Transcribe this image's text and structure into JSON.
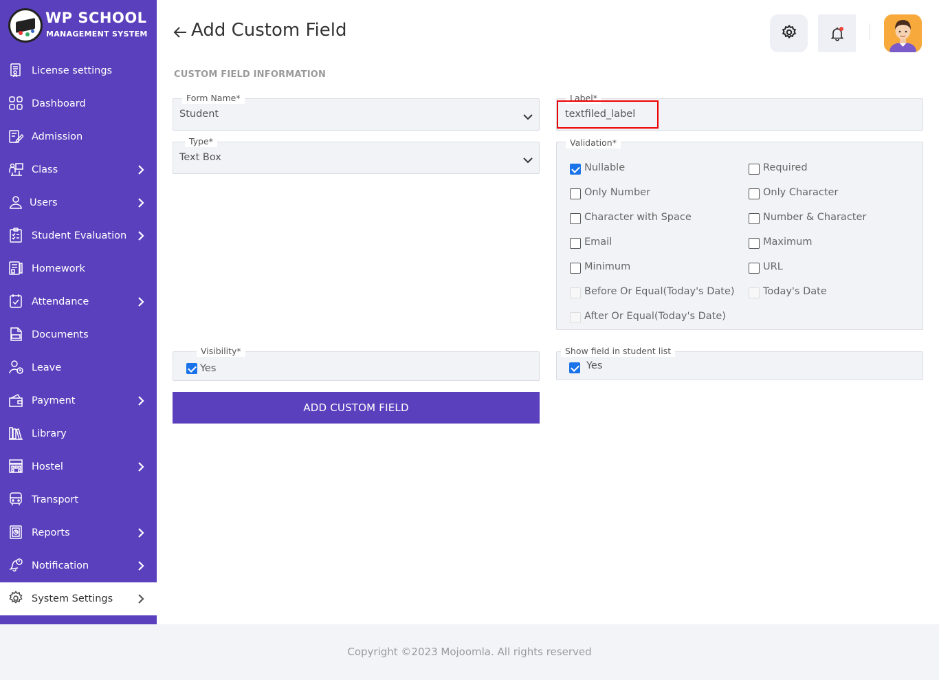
{
  "app": {
    "logo_title": "WP SCHOOL",
    "logo_subtitle": "MANAGEMENT SYSTEM"
  },
  "sidebar": {
    "items": [
      {
        "label": "License settings",
        "icon": "license-icon",
        "has_submenu": false
      },
      {
        "label": "Dashboard",
        "icon": "dashboard-icon",
        "has_submenu": false
      },
      {
        "label": "Admission",
        "icon": "admission-icon",
        "has_submenu": false
      },
      {
        "label": "Class",
        "icon": "class-icon",
        "has_submenu": true
      },
      {
        "label": "Users",
        "icon": "users-icon",
        "has_submenu": true
      },
      {
        "label": "Student Evaluation",
        "icon": "evaluation-icon",
        "has_submenu": true
      },
      {
        "label": "Homework",
        "icon": "homework-icon",
        "has_submenu": false
      },
      {
        "label": "Attendance",
        "icon": "attendance-icon",
        "has_submenu": true
      },
      {
        "label": "Documents",
        "icon": "documents-icon",
        "has_submenu": false
      },
      {
        "label": "Leave",
        "icon": "leave-icon",
        "has_submenu": false
      },
      {
        "label": "Payment",
        "icon": "payment-icon",
        "has_submenu": true
      },
      {
        "label": "Library",
        "icon": "library-icon",
        "has_submenu": false
      },
      {
        "label": "Hostel",
        "icon": "hostel-icon",
        "has_submenu": true
      },
      {
        "label": "Transport",
        "icon": "transport-icon",
        "has_submenu": false
      },
      {
        "label": "Reports",
        "icon": "reports-icon",
        "has_submenu": true
      },
      {
        "label": "Notification",
        "icon": "notification-icon",
        "has_submenu": true
      },
      {
        "label": "System Settings",
        "icon": "gear-icon",
        "has_submenu": true,
        "active": true
      }
    ]
  },
  "header": {
    "title": "Add Custom Field"
  },
  "form": {
    "section_title": "CUSTOM FIELD INFORMATION",
    "form_name": {
      "legend": "Form Name*",
      "value": "Student"
    },
    "type": {
      "legend": "Type*",
      "value": "Text Box"
    },
    "label": {
      "legend": "Label*",
      "value": "textfiled_label"
    },
    "validation": {
      "legend": "Validation*",
      "options": [
        {
          "label": "Nullable",
          "checked": true,
          "disabled": false
        },
        {
          "label": "Required",
          "checked": false,
          "disabled": false
        },
        {
          "label": "Only Number",
          "checked": false,
          "disabled": false
        },
        {
          "label": "Only Character",
          "checked": false,
          "disabled": false
        },
        {
          "label": "Character with Space",
          "checked": false,
          "disabled": false
        },
        {
          "label": "Number & Character",
          "checked": false,
          "disabled": false
        },
        {
          "label": "Email",
          "checked": false,
          "disabled": false
        },
        {
          "label": "Maximum",
          "checked": false,
          "disabled": false
        },
        {
          "label": "Minimum",
          "checked": false,
          "disabled": false
        },
        {
          "label": "URL",
          "checked": false,
          "disabled": false
        },
        {
          "label": "Before Or Equal(Today's Date)",
          "checked": false,
          "disabled": true
        },
        {
          "label": "Today's Date",
          "checked": false,
          "disabled": true
        },
        {
          "label": "After Or Equal(Today's Date)",
          "checked": false,
          "disabled": true
        }
      ]
    },
    "visibility": {
      "legend": "Visibility*",
      "option_label": "Yes",
      "checked": true
    },
    "show_in_list": {
      "legend": "Show field in student list",
      "option_label": "Yes",
      "checked": true
    },
    "submit_label": "ADD CUSTOM FIELD"
  },
  "footer": {
    "text": "Copyright ©2023 Mojoomla. All rights reserved"
  },
  "colors": {
    "sidebar_bg": "#5b40bd",
    "primary_button": "#5b40bd",
    "checkbox_checked": "#1a73e8",
    "highlight_border": "#ee0000"
  }
}
